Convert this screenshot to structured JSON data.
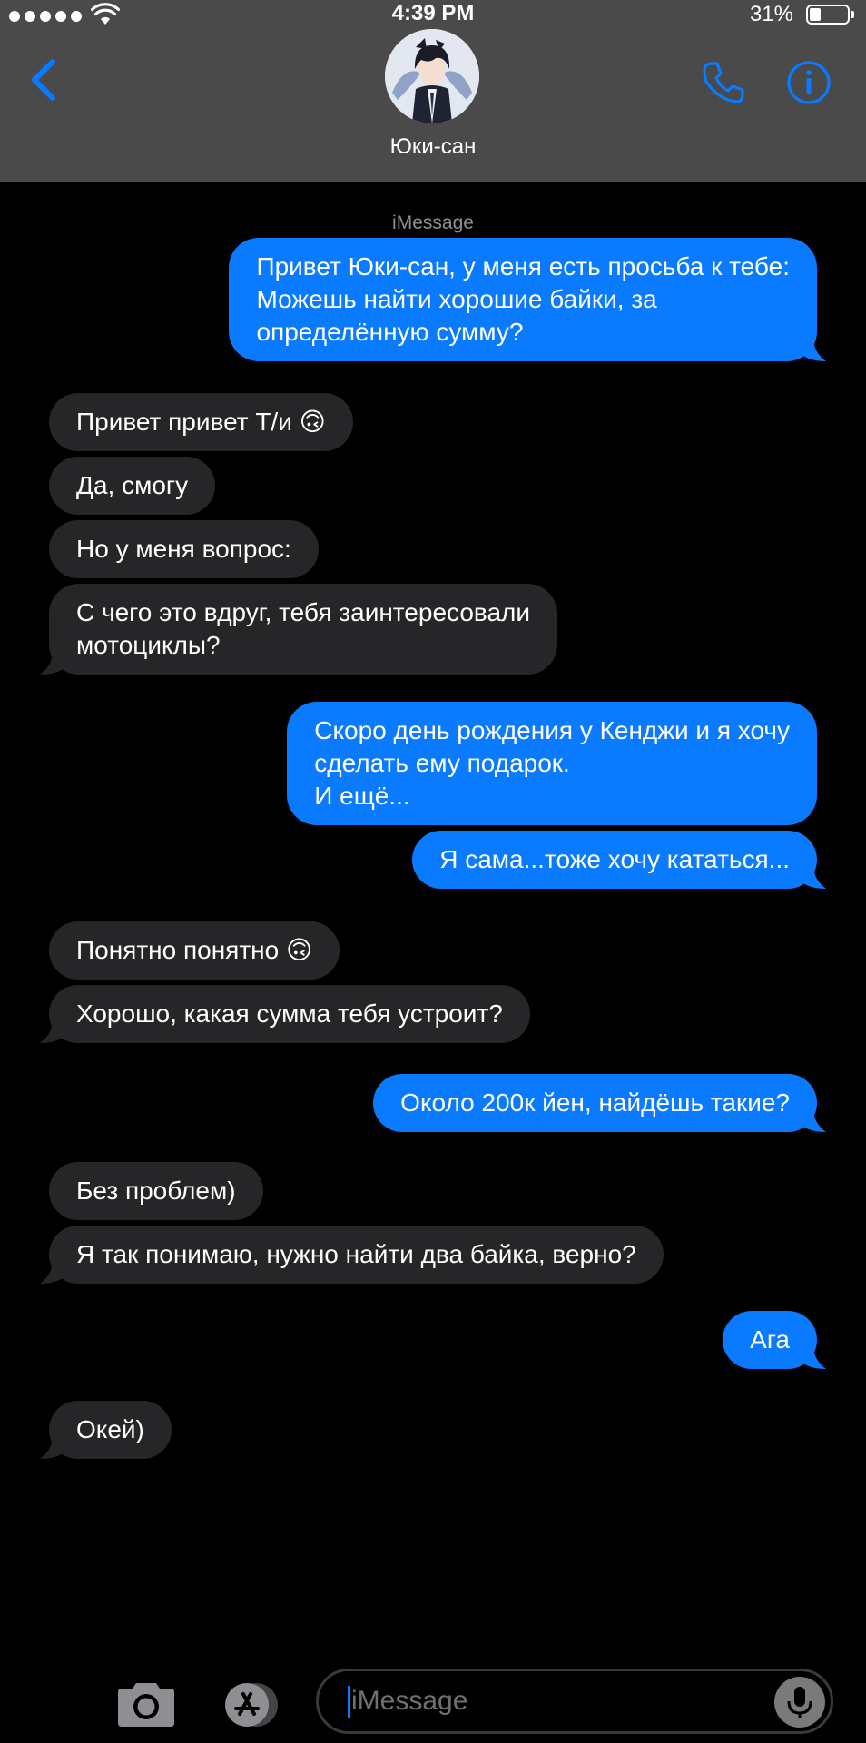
{
  "status_bar": {
    "time": "4:39 PM",
    "battery_percent": "31%",
    "battery_level": 0.31,
    "signal_bars": 5
  },
  "header": {
    "contact_name": "Юки-сан",
    "icons": {
      "back": "chevron-left-icon",
      "call": "phone-icon",
      "info": "info-icon"
    },
    "accent_color": "#0a7aff",
    "background_color": "#4a4a4a"
  },
  "conversation": {
    "service_label": "iMessage",
    "incoming_bubble_color": "#262628",
    "outgoing_bubble_color": "#0a7aff",
    "messages": [
      {
        "side": "out",
        "text": "Привет Юки-сан, у меня есть просьба к тебе:\nМожешь найти хорошие байки, за\nопределённую сумму?"
      },
      {
        "side": "in",
        "text": "Привет привет Т/и 🙃"
      },
      {
        "side": "in",
        "text": "Да, смогу"
      },
      {
        "side": "in",
        "text": "Но у меня вопрос:"
      },
      {
        "side": "in",
        "text": "С чего это вдруг, тебя заинтересовали\nмотоциклы?"
      },
      {
        "side": "out",
        "text": "Скоро день рождения у Кенджи и я хочу\nсделать ему подарок.\nИ ещё..."
      },
      {
        "side": "out",
        "text": "Я сама...тоже хочу кататься..."
      },
      {
        "side": "in",
        "text": "Понятно понятно 🙃"
      },
      {
        "side": "in",
        "text": "Хорошо, какая сумма тебя устроит?"
      },
      {
        "side": "out",
        "text": "Около 200к йен, найдёшь такие?"
      },
      {
        "side": "in",
        "text": "Без проблем)"
      },
      {
        "side": "in",
        "text": "Я так понимаю, нужно найти два байка, верно?"
      },
      {
        "side": "out",
        "text": "Ага"
      },
      {
        "side": "in",
        "text": "Окей)"
      }
    ]
  },
  "input_bar": {
    "placeholder": "iMessage",
    "value": "",
    "icons": {
      "camera": "camera-icon",
      "apps": "app-store-icon",
      "mic": "microphone-icon"
    }
  }
}
